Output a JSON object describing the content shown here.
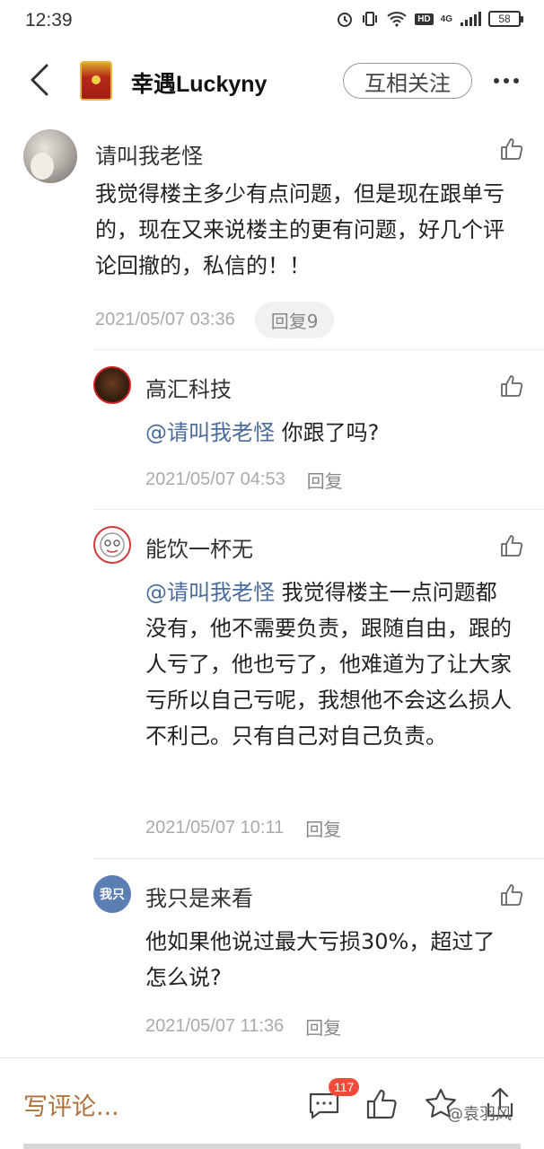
{
  "status_bar": {
    "time": "12:39",
    "network_label": "4G",
    "hd_label": "HD",
    "battery": "58"
  },
  "header": {
    "title": "幸遇Luckyny",
    "follow_label": "互相关注",
    "icons": [
      "back-arrow-icon",
      "more-icon"
    ]
  },
  "main_comment": {
    "author": "请叫我老怪",
    "text": "我觉得楼主多少有点问题，但是现在跟单亏的，现在又来说楼主的更有问题，好几个评论回撤的，私信的！！",
    "timestamp": "2021/05/07 03:36",
    "reply_label": "回复9"
  },
  "replies": [
    {
      "author": "高汇科技",
      "mention": "@请叫我老怪",
      "text": " 你跟了吗?",
      "timestamp": "2021/05/07 04:53",
      "reply_label": "回复"
    },
    {
      "author": "能饮一杯无",
      "mention": "@请叫我老怪",
      "text": " 我觉得楼主一点问题都没有，他不需要负责，跟随自由，跟的人亏了，他也亏了，他难道为了让大家亏所以自己亏呢，我想他不会这么损人不利己。只有自己对自己负责。",
      "timestamp": "2021/05/07 10:11",
      "reply_label": "回复"
    },
    {
      "author": "我只是来看",
      "avatar_text": "我只",
      "mention": "",
      "text": "他如果他说过最大亏损30%，超过了怎么说?",
      "timestamp": "2021/05/07 11:36",
      "reply_label": "回复"
    }
  ],
  "bottom_bar": {
    "write_comment_placeholder": "写评论...",
    "comment_count": "117",
    "watermark": "@袁羽风",
    "icons": [
      "comment-icon",
      "like-icon",
      "star-icon",
      "share-icon"
    ]
  },
  "colors": {
    "mention": "#4a6c9b",
    "write_comment": "#b0703a",
    "badge": "#f04a3a"
  }
}
